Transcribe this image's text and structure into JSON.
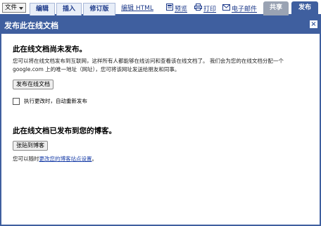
{
  "toolbar": {
    "file_menu": "文件",
    "tabs": [
      "编辑",
      "插入",
      "修订版",
      "编辑 HTML"
    ],
    "actions": [
      "预览",
      "打印",
      "电子邮件"
    ],
    "share_tab": "共享",
    "publish_tab": "发布"
  },
  "dialog": {
    "title": "发布此在线文档",
    "close_symbol": "×",
    "section1": {
      "heading": "此在线文档尚未发布。",
      "description": "您可以将在线文档发布到互联网，这样所有人都能够在线访问和查看该在线文档了。  我们会为您的在线文档分配一个 google.com 上的唯一地址（网址），您可将该网址发送给朋友和同事。",
      "button": "发布在线文档",
      "checkbox_label": "执行更改时，自动重新发布"
    },
    "section2": {
      "heading": "此在线文档已发布到您的博客。",
      "button": "张贴到博客",
      "text_prefix": "您可以随时",
      "link_text": "更改您的博客站点设置",
      "text_suffix": "。"
    }
  }
}
